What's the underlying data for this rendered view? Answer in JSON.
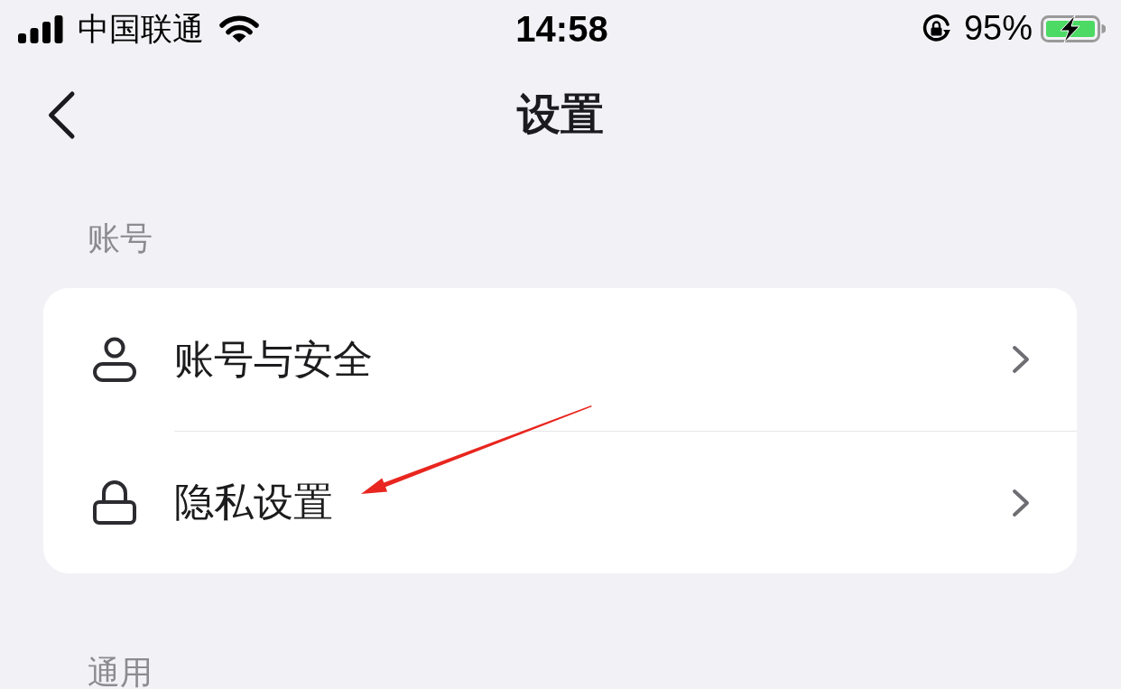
{
  "status_bar": {
    "carrier": "中国联通",
    "time": "14:58",
    "orientation_lock": true,
    "battery": "95%",
    "charging": true
  },
  "nav": {
    "title": "设置"
  },
  "sections": [
    {
      "header": "账号",
      "items": [
        {
          "label": "账号与安全"
        },
        {
          "label": "隐私设置"
        }
      ]
    },
    {
      "header": "通用"
    }
  ]
}
